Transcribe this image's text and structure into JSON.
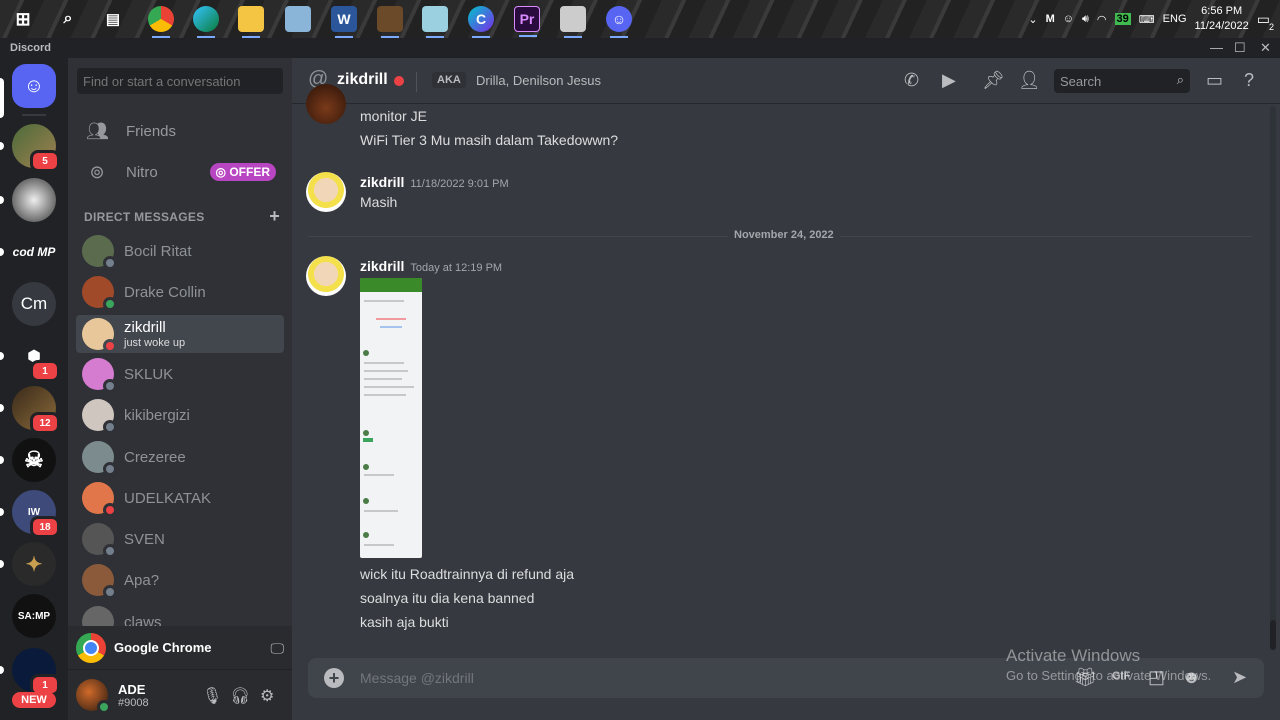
{
  "taskbar": {
    "clock_time": "6:56 PM",
    "clock_date": "11/24/2022",
    "lang": "ENG",
    "battery": "39",
    "notif_count": "2",
    "apps": [
      "windows-start",
      "search",
      "task-view",
      "chrome",
      "edge",
      "file-explorer",
      "photos",
      "word",
      "game",
      "tool",
      "canva",
      "premiere",
      "mixer",
      "discord"
    ]
  },
  "titlebar": {
    "app_name": "Discord"
  },
  "rail": {
    "servers": [
      {
        "name": "home",
        "label": ""
      },
      {
        "name": "server-1",
        "label": "",
        "mentions": "5"
      },
      {
        "name": "server-2",
        "label": ""
      },
      {
        "name": "server-codmp",
        "label": "cod MP"
      },
      {
        "name": "server-cm",
        "label": "Cm"
      },
      {
        "name": "server-5",
        "label": "",
        "mentions": "1"
      },
      {
        "name": "server-6",
        "label": "",
        "mentions": "12"
      },
      {
        "name": "server-7",
        "label": "☠"
      },
      {
        "name": "server-8",
        "label": "IW",
        "mentions": "18"
      },
      {
        "name": "server-9",
        "label": ""
      },
      {
        "name": "server-samp",
        "label": "SA:MP"
      },
      {
        "name": "server-11",
        "label": "",
        "mentions": "1"
      }
    ],
    "new_badge": "NEW"
  },
  "dm_sidebar": {
    "search_placeholder": "Find or start a conversation",
    "friends_label": "Friends",
    "nitro_label": "Nitro",
    "offer_label": "OFFER",
    "dm_header": "DIRECT MESSAGES",
    "dms": [
      {
        "name": "Bocil Ritat",
        "status": "offline",
        "color": "#5b6b4e"
      },
      {
        "name": "Drake Collin",
        "status": "online",
        "color": "#a04a2a"
      },
      {
        "name": "zikdrill",
        "sub": "just woke up",
        "status": "dnd",
        "color": "#e8c89a",
        "selected": true
      },
      {
        "name": "SKLUK",
        "status": "offline",
        "color": "#d57bd0"
      },
      {
        "name": "kikibergizi",
        "status": "offline",
        "color": "#cfc6c0"
      },
      {
        "name": "Crezeree",
        "status": "offline",
        "color": "#7b8b8e"
      },
      {
        "name": "UDELKATAK",
        "status": "dnd",
        "color": "#e0764a"
      },
      {
        "name": "SVEN",
        "status": "offline",
        "color": "#555"
      },
      {
        "name": "Apa?",
        "status": "offline",
        "color": "#8a5a3a"
      },
      {
        "name": "claws",
        "status": "offline",
        "color": "#666"
      }
    ],
    "activity_label": "Google Chrome",
    "user_name": "ADE",
    "user_tag": "#9008"
  },
  "chat": {
    "channel_name": "zikdrill",
    "aka_label": "AKA",
    "aka_names": "Drilla, Denilson Jesus",
    "search_placeholder": "Search",
    "messages_top": [
      "monitor JE",
      "WiFi Tier 3 Mu masih dalam Takedowwn?"
    ],
    "msg1": {
      "author": "zikdrill",
      "timestamp": "11/18/2022 9:01 PM",
      "text": "Masih"
    },
    "date_separator": "November 24, 2022",
    "msg2": {
      "author": "zikdrill",
      "timestamp": "Today at 12:19 PM",
      "lines": [
        "wick itu Roadtrainnya di refund aja",
        "soalnya itu dia kena banned",
        "kasih aja bukti"
      ]
    },
    "composer_placeholder": "Message @zikdrill",
    "watermark_title": "Activate Windows",
    "watermark_sub": "Go to Settings to activate Windows."
  }
}
